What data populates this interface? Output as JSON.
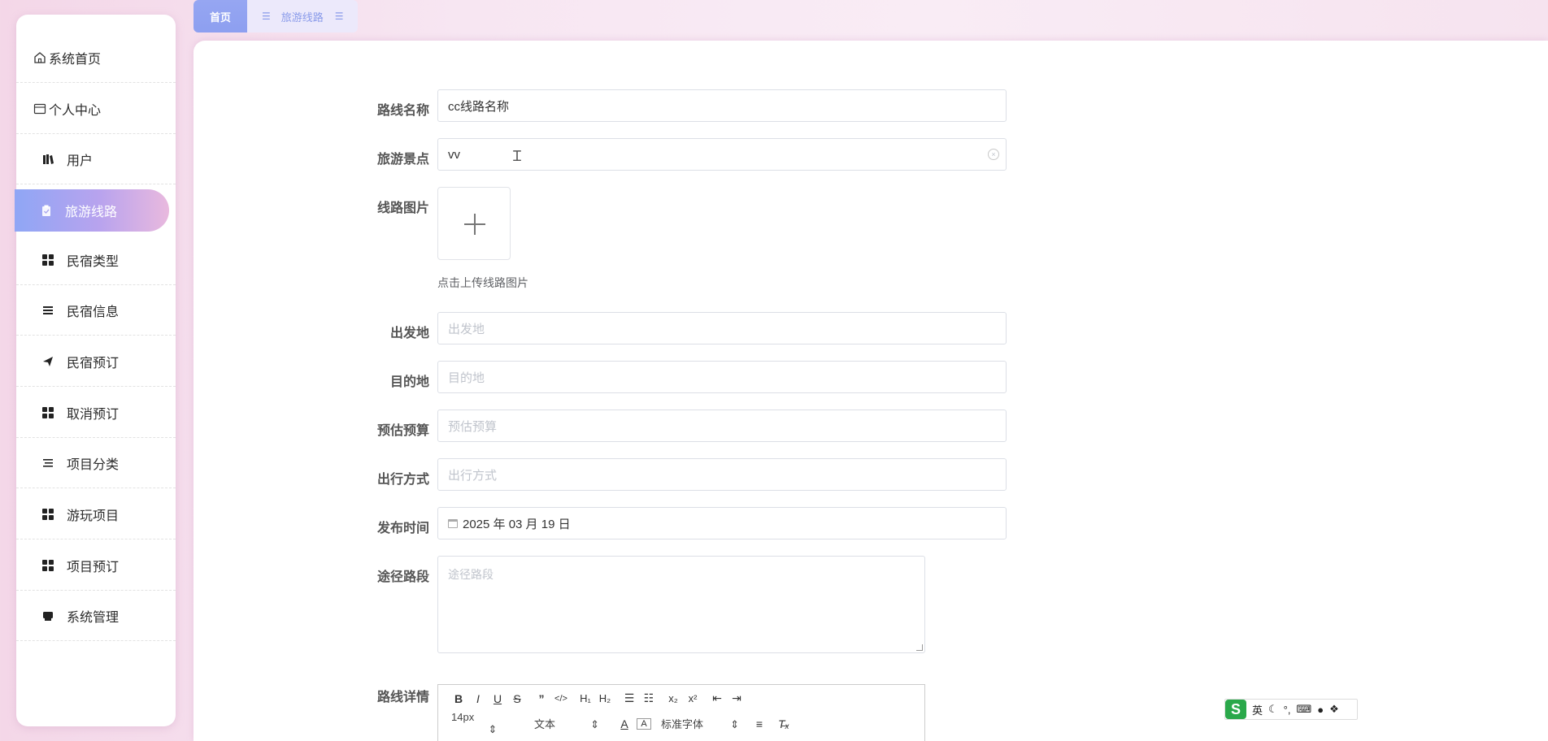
{
  "sidebar": {
    "items": [
      {
        "label": "系统首页",
        "icon": "home-icon"
      },
      {
        "label": "个人中心",
        "icon": "id-card-icon"
      },
      {
        "label": "用户",
        "icon": "books-icon"
      },
      {
        "label": "旅游线路",
        "icon": "clipboard-icon",
        "active": true
      },
      {
        "label": "民宿类型",
        "icon": "grid-icon"
      },
      {
        "label": "民宿信息",
        "icon": "list-icon"
      },
      {
        "label": "民宿预订",
        "icon": "send-icon"
      },
      {
        "label": "取消预订",
        "icon": "grid-icon"
      },
      {
        "label": "项目分类",
        "icon": "list-icon"
      },
      {
        "label": "游玩项目",
        "icon": "grid-icon"
      },
      {
        "label": "项目预订",
        "icon": "grid-icon"
      },
      {
        "label": "系统管理",
        "icon": "printer-icon"
      }
    ]
  },
  "tabs": {
    "home": "首页",
    "route": "旅游线路"
  },
  "form": {
    "route_name": {
      "label": "路线名称",
      "value": "cc线路名称"
    },
    "scenic_spot": {
      "label": "旅游景点",
      "value": "vv"
    },
    "route_image": {
      "label": "线路图片",
      "tip": "点击上传线路图片"
    },
    "departure": {
      "label": "出发地",
      "placeholder": "出发地"
    },
    "destination": {
      "label": "目的地",
      "placeholder": "目的地"
    },
    "budget": {
      "label": "预估预算",
      "placeholder": "预估预算"
    },
    "travel_mode": {
      "label": "出行方式",
      "placeholder": "出行方式"
    },
    "publish_time": {
      "label": "发布时间",
      "value": "2025 年 03 月 19 日"
    },
    "via_section": {
      "label": "途径路段",
      "placeholder": "途径路段"
    },
    "route_detail": {
      "label": "路线详情"
    }
  },
  "editor": {
    "toolbar_row1": [
      "B",
      "I",
      "U",
      "S",
      "”",
      "</>",
      "H1",
      "H2",
      "ol",
      "ul",
      "x2",
      "x2",
      "outdent",
      "indent"
    ],
    "font_size": "14px",
    "block_type": "文本",
    "font_family": "标准字体"
  },
  "ime": {
    "logo": "S",
    "lang": "英"
  }
}
